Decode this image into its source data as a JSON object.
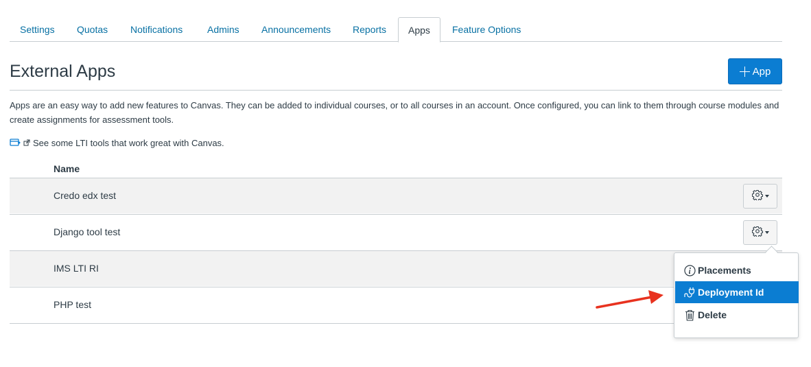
{
  "tabs": [
    {
      "label": "Settings"
    },
    {
      "label": "Quotas"
    },
    {
      "label": "Notifications"
    },
    {
      "label": "Admins"
    },
    {
      "label": "Announcements"
    },
    {
      "label": "Reports"
    },
    {
      "label": "Apps",
      "active": true
    },
    {
      "label": "Feature Options"
    }
  ],
  "header": {
    "title": "External Apps",
    "add_button_label": "App"
  },
  "description": "Apps are an easy way to add new features to Canvas. They can be added to individual courses, or to all courses in an account. Once configured, you can link to them through course modules and create assignments for assessment tools.",
  "lti_link": "See some LTI tools that work great with Canvas.",
  "table": {
    "column_header": "Name",
    "rows": [
      {
        "name": "Credo edx test"
      },
      {
        "name": "Django tool test"
      },
      {
        "name": "IMS LTI RI"
      },
      {
        "name": "PHP test"
      }
    ]
  },
  "menu": {
    "items": [
      {
        "label": "Placements",
        "icon": "info-icon"
      },
      {
        "label": "Deployment Id",
        "icon": "plug-icon",
        "highlighted": true
      },
      {
        "label": "Delete",
        "icon": "trash-icon"
      }
    ]
  },
  "colors": {
    "accent": "#0b7dd2",
    "link": "#0770a3",
    "text": "#2d3b45",
    "annotation_arrow": "#e8321f"
  }
}
